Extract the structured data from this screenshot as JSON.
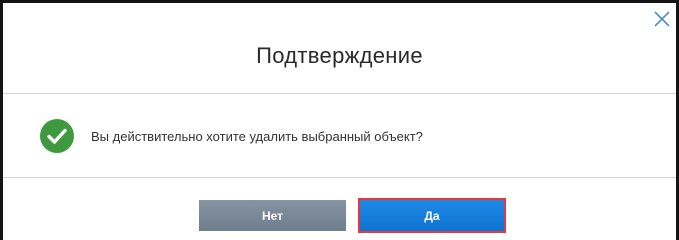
{
  "dialog": {
    "title": "Подтверждение",
    "message": "Вы действительно хотите удалить выбранный объект?",
    "close_icon": "close-icon",
    "status_icon": "check-circle-icon"
  },
  "buttons": {
    "no_label": "Нет",
    "yes_label": "Да"
  },
  "colors": {
    "check_icon": "#3f9a3f",
    "no_button": "#7b8a98",
    "yes_button": "#1680df",
    "yes_button_highlight": "#e23a3a",
    "close_icon": "#4f8ec2"
  }
}
